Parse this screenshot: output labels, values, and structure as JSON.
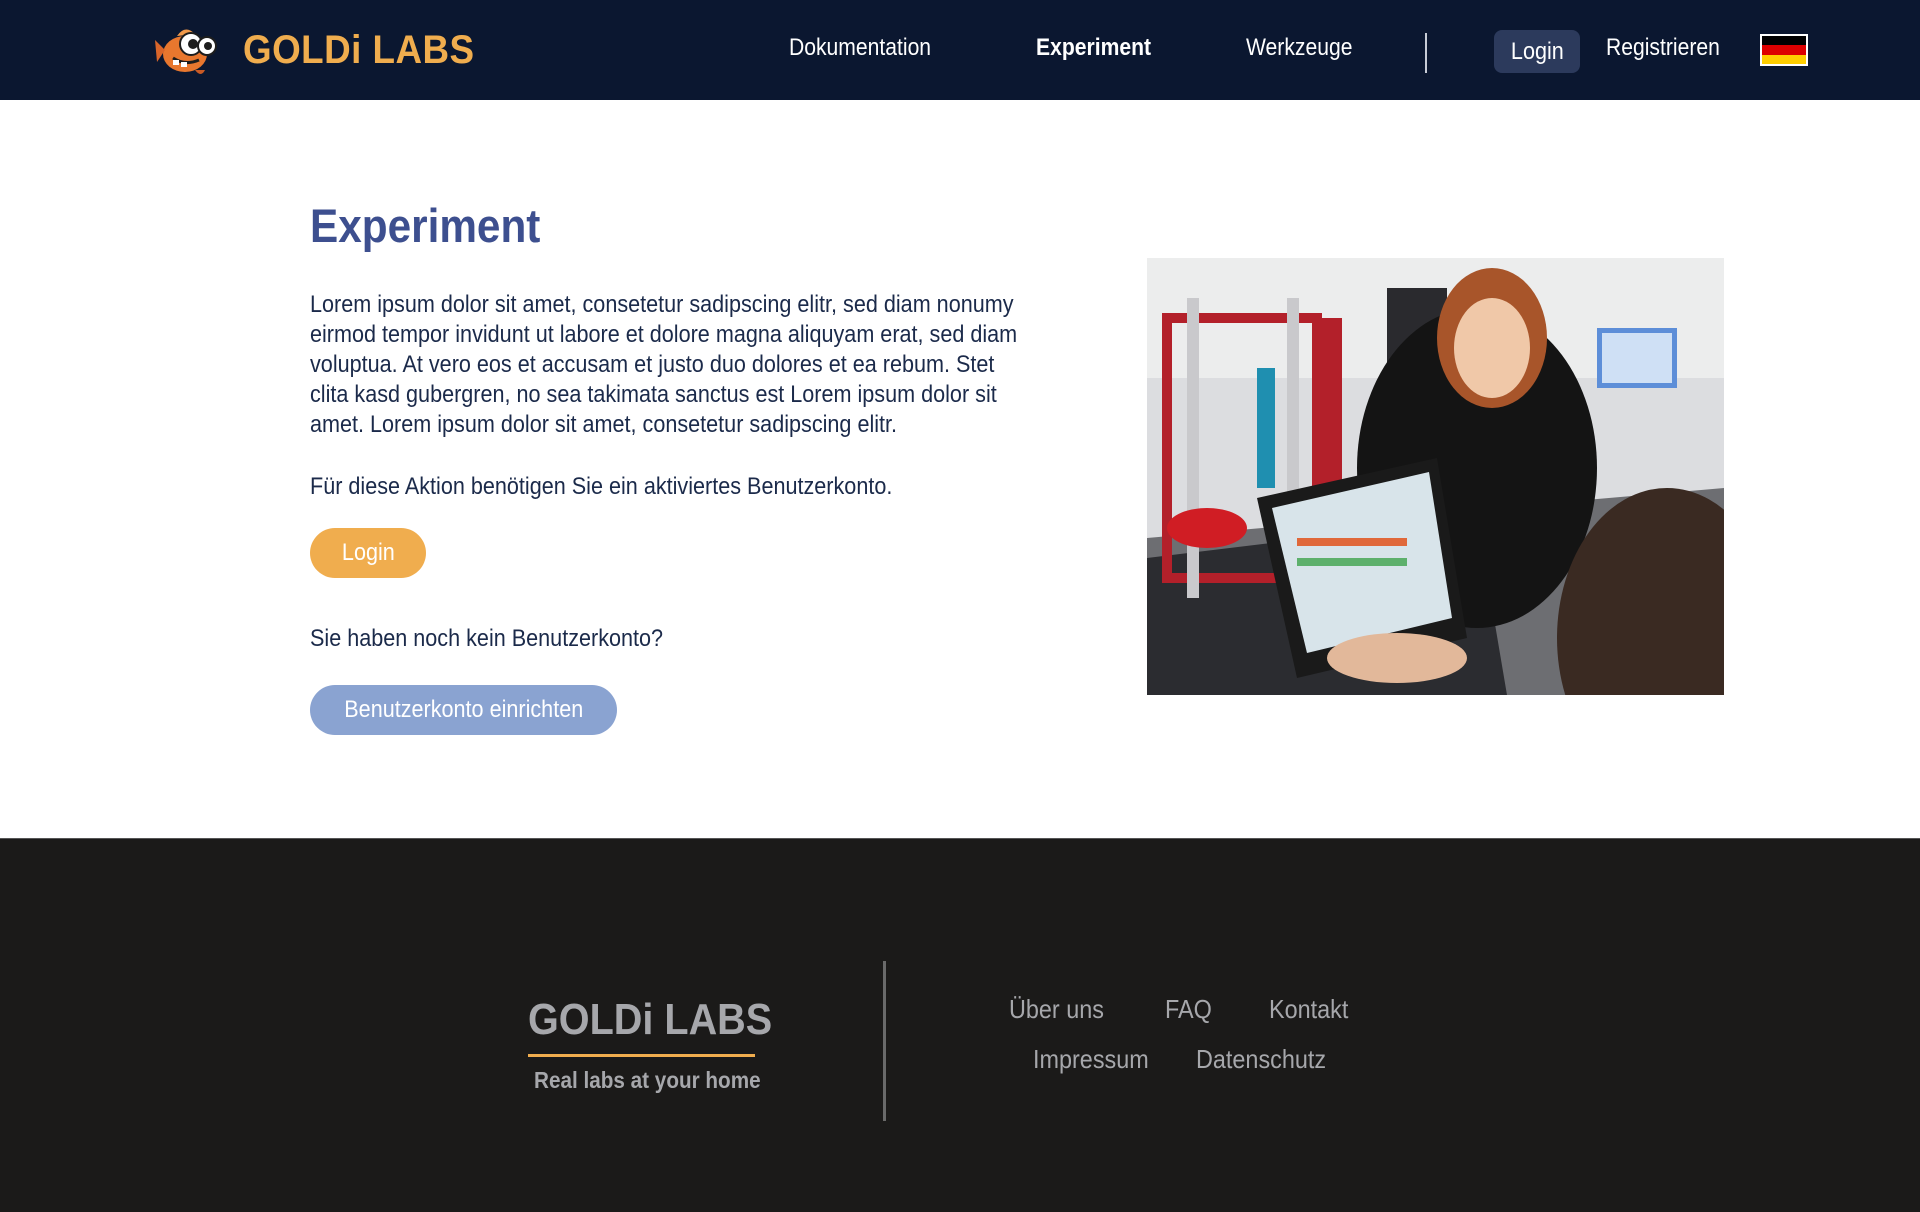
{
  "header": {
    "brand": "GOLDi LABS",
    "nav": [
      {
        "label": "Dokumentation"
      },
      {
        "label": "Experiment",
        "active": true
      },
      {
        "label": "Werkzeuge"
      }
    ],
    "login_label": "Login",
    "register_label": "Registrieren",
    "language_flag": "german-flag-icon"
  },
  "main": {
    "title": "Experiment",
    "paragraph": "Lorem ipsum dolor sit amet, consetetur sadipscing elitr, sed diam nonumy eirmod tempor invidunt ut labore et dolore magna aliquyam erat, sed diam voluptua. At vero eos et accusam et justo duo dolores et ea rebum. Stet clita kasd gubergren, no sea takimata sanctus est Lorem ipsum dolor sit amet. Lorem ipsum dolor sit amet, consetetur sadipscing elitr.",
    "account_hint": "Für diese Aktion benötigen Sie ein aktiviertes Benutzerkonto.",
    "login_button": "Login",
    "no_account_question": "Sie haben noch kein Benutzerkonto?",
    "register_button": "Benutzerkonto einrichten"
  },
  "footer": {
    "brand": "GOLDi LABS",
    "tagline": "Real labs at your home",
    "links": [
      "Über uns",
      "FAQ",
      "Kontakt",
      "Impressum",
      "Datenschutz"
    ]
  },
  "colors": {
    "header_bg": "#0b1730",
    "accent_orange": "#f0ad4e",
    "title_blue": "#3d4f8f",
    "register_button": "#8aa3d1",
    "footer_bg": "#1b1a19"
  }
}
